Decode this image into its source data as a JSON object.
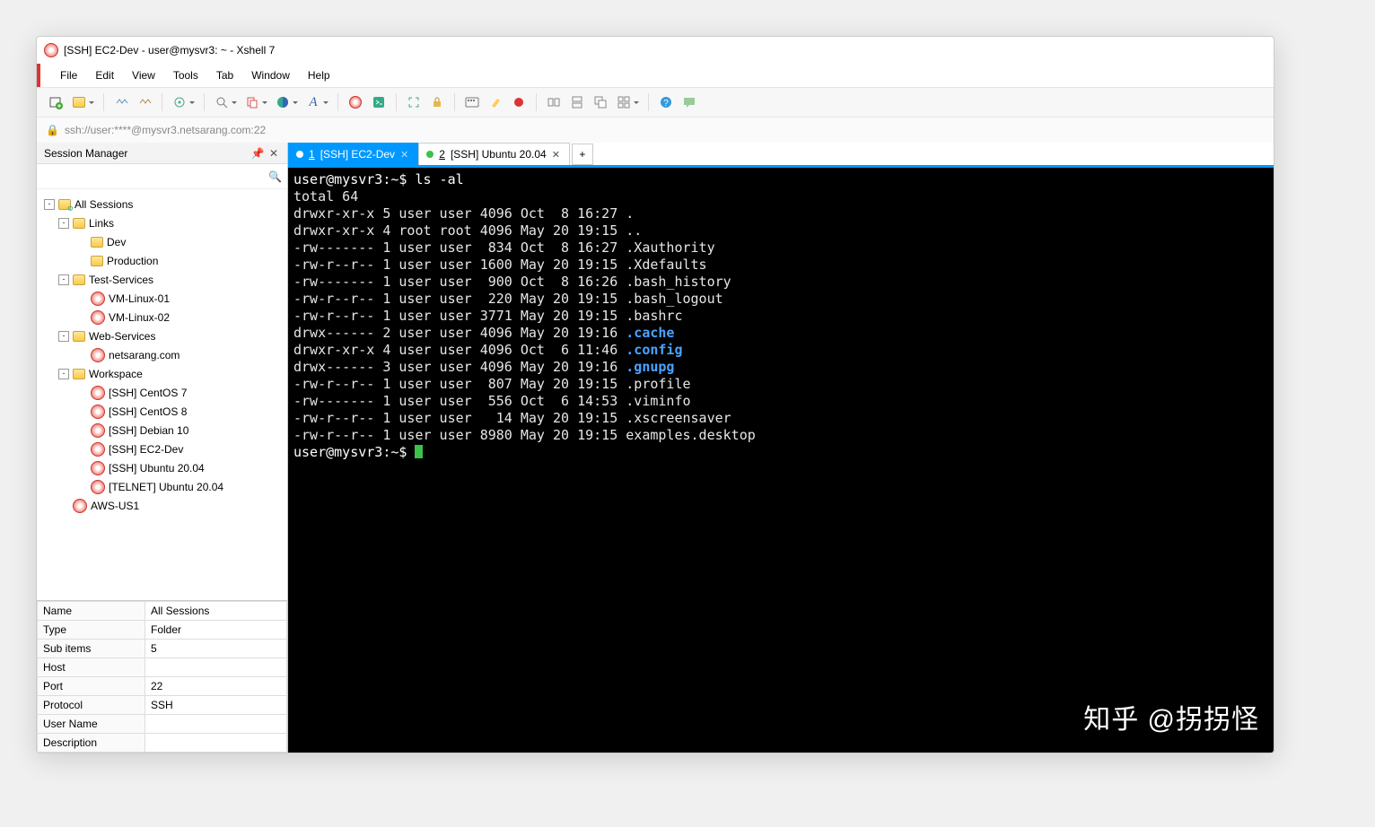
{
  "window": {
    "title": "[SSH] EC2-Dev - user@mysvr3: ~ - Xshell 7"
  },
  "menus": [
    "File",
    "Edit",
    "View",
    "Tools",
    "Tab",
    "Window",
    "Help"
  ],
  "address": "ssh://user:****@mysvr3.netsarang.com:22",
  "sessionPane": {
    "title": "Session Manager",
    "searchPlaceholder": ""
  },
  "tree": [
    {
      "d": 0,
      "exp": "-",
      "icon": "folder-gear",
      "label": "All Sessions"
    },
    {
      "d": 1,
      "exp": "-",
      "icon": "folder",
      "label": "Links"
    },
    {
      "d": 2,
      "exp": "",
      "icon": "folder",
      "label": "Dev"
    },
    {
      "d": 2,
      "exp": "",
      "icon": "folder",
      "label": "Production"
    },
    {
      "d": 1,
      "exp": "-",
      "icon": "folder",
      "label": "Test-Services"
    },
    {
      "d": 2,
      "exp": "",
      "icon": "swirl",
      "label": "VM-Linux-01"
    },
    {
      "d": 2,
      "exp": "",
      "icon": "swirl",
      "label": "VM-Linux-02"
    },
    {
      "d": 1,
      "exp": "-",
      "icon": "folder",
      "label": "Web-Services"
    },
    {
      "d": 2,
      "exp": "",
      "icon": "swirl",
      "label": "netsarang.com"
    },
    {
      "d": 1,
      "exp": "-",
      "icon": "folder",
      "label": "Workspace"
    },
    {
      "d": 2,
      "exp": "",
      "icon": "swirl",
      "label": "[SSH] CentOS 7"
    },
    {
      "d": 2,
      "exp": "",
      "icon": "swirl",
      "label": "[SSH] CentOS 8"
    },
    {
      "d": 2,
      "exp": "",
      "icon": "swirl",
      "label": "[SSH] Debian 10"
    },
    {
      "d": 2,
      "exp": "",
      "icon": "swirl",
      "label": "[SSH] EC2-Dev"
    },
    {
      "d": 2,
      "exp": "",
      "icon": "swirl",
      "label": "[SSH] Ubuntu 20.04"
    },
    {
      "d": 2,
      "exp": "",
      "icon": "swirl",
      "label": "[TELNET] Ubuntu 20.04"
    },
    {
      "d": 1,
      "exp": "",
      "icon": "swirl",
      "label": "AWS-US1"
    }
  ],
  "props": [
    [
      "Name",
      "All Sessions"
    ],
    [
      "Type",
      "Folder"
    ],
    [
      "Sub items",
      "5"
    ],
    [
      "Host",
      ""
    ],
    [
      "Port",
      "22"
    ],
    [
      "Protocol",
      "SSH"
    ],
    [
      "User Name",
      ""
    ],
    [
      "Description",
      ""
    ]
  ],
  "tabs": [
    {
      "num": "1",
      "label": "[SSH] EC2-Dev",
      "active": true,
      "dot": "blue"
    },
    {
      "num": "2",
      "label": "[SSH] Ubuntu 20.04",
      "active": false,
      "dot": "green"
    }
  ],
  "terminal": {
    "prompt1": "user@mysvr3:~$ ",
    "cmd1": "ls -al",
    "lines": [
      "total 64",
      "drwxr-xr-x 5 user user 4096 Oct  8 16:27 .",
      "drwxr-xr-x 4 root root 4096 May 20 19:15 ..",
      "-rw------- 1 user user  834 Oct  8 16:27 .Xauthority",
      "-rw-r--r-- 1 user user 1600 May 20 19:15 .Xdefaults",
      "-rw------- 1 user user  900 Oct  8 16:26 .bash_history",
      "-rw-r--r-- 1 user user  220 May 20 19:15 .bash_logout",
      "-rw-r--r-- 1 user user 3771 May 20 19:15 .bashrc"
    ],
    "dirs": [
      {
        "meta": "drwx------ 2 user user 4096 May 20 19:16 ",
        "name": ".cache"
      },
      {
        "meta": "drwxr-xr-x 4 user user 4096 Oct  6 11:46 ",
        "name": ".config"
      },
      {
        "meta": "drwx------ 3 user user 4096 May 20 19:16 ",
        "name": ".gnupg"
      }
    ],
    "lines2": [
      "-rw-r--r-- 1 user user  807 May 20 19:15 .profile",
      "-rw------- 1 user user  556 Oct  6 14:53 .viminfo",
      "-rw-r--r-- 1 user user   14 May 20 19:15 .xscreensaver",
      "-rw-r--r-- 1 user user 8980 May 20 19:15 examples.desktop"
    ],
    "prompt2": "user@mysvr3:~$ "
  },
  "watermark": "知乎 @拐拐怪"
}
